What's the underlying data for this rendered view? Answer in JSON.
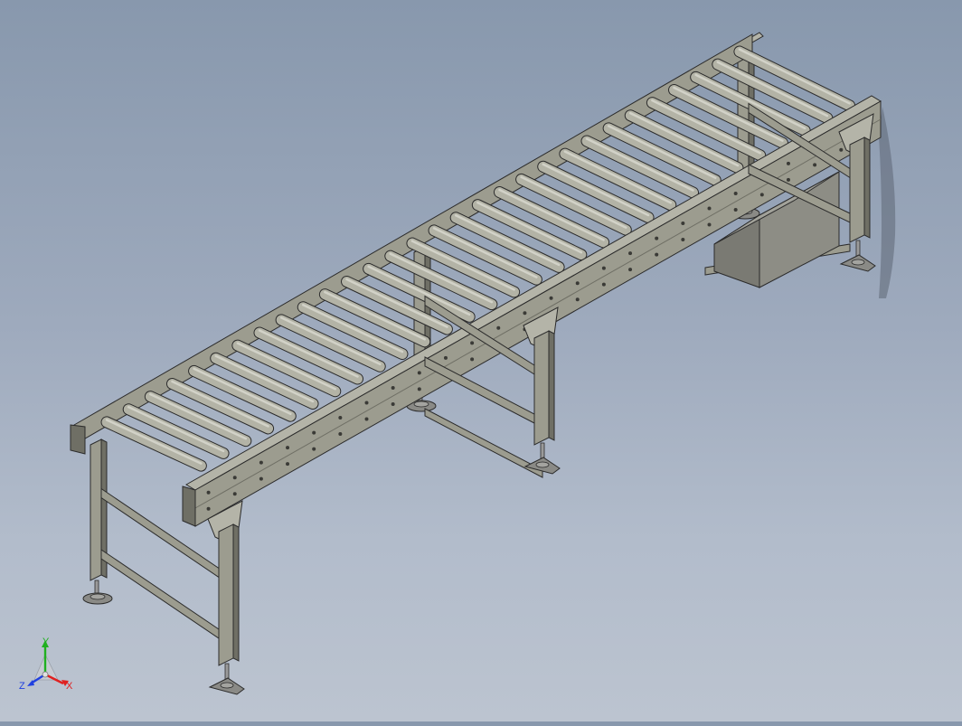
{
  "viewport": {
    "model": "roller-conveyor",
    "roller_count": 30,
    "support_leg_pairs": 3,
    "colors": {
      "background_top": "#8898ad",
      "background_bottom": "#bcc4d0",
      "frame_fill": "#9c9c8f",
      "frame_light": "#b4b4a8",
      "frame_dark": "#6f6f65",
      "roller_fill": "#b3b3a6",
      "roller_highlight": "#d2d2c8",
      "edge": "#2b2b2b",
      "motor_box": "#8d8d85",
      "motor_box_dark": "#7a7a73"
    }
  },
  "triad": {
    "x_label": "X",
    "y_label": "Y",
    "z_label": "Z",
    "x_color": "#e02020",
    "y_color": "#20b020",
    "z_color": "#2040e0"
  }
}
